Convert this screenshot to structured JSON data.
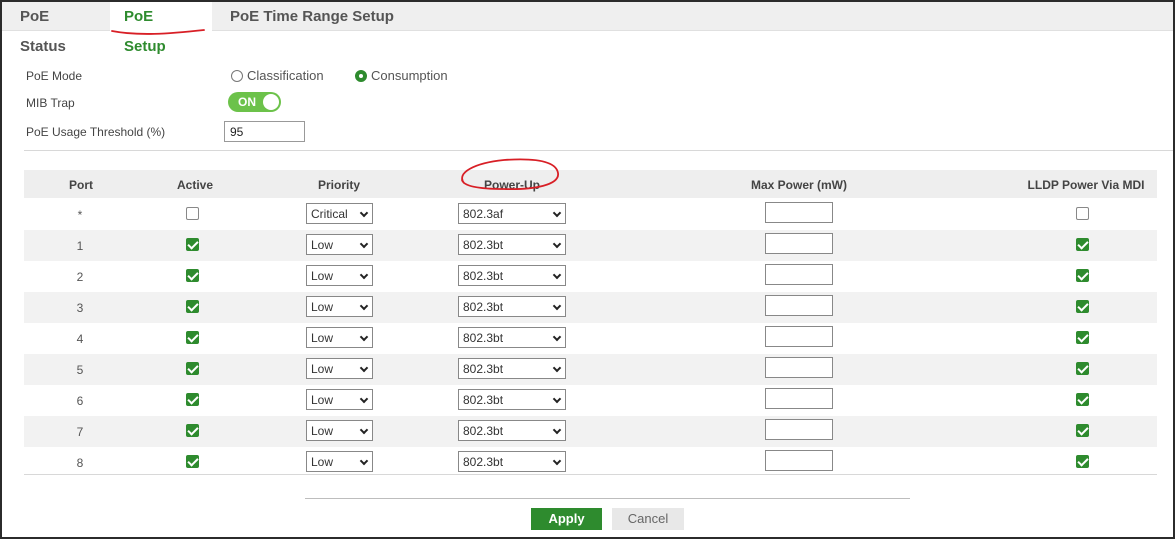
{
  "tabs": [
    {
      "label": "PoE Status",
      "active": false
    },
    {
      "label": "PoE Setup",
      "active": true
    },
    {
      "label": "PoE Time Range Setup",
      "active": false
    }
  ],
  "settings": {
    "poe_mode_label": "PoE Mode",
    "mode_options": [
      "Classification",
      "Consumption"
    ],
    "mode_selected": "Consumption",
    "mib_trap_label": "MIB Trap",
    "mib_trap_state": "ON",
    "threshold_label": "PoE Usage Threshold (%)",
    "threshold_value": "95"
  },
  "table": {
    "headers": {
      "port": "Port",
      "active": "Active",
      "priority": "Priority",
      "power_up": "Power-Up",
      "max_power": "Max Power (mW)",
      "lldp": "LLDP Power Via MDI"
    },
    "rows": [
      {
        "port": "*",
        "active": false,
        "priority": "Critical",
        "power_up": "802.3af",
        "max_power": "",
        "lldp": false
      },
      {
        "port": "1",
        "active": true,
        "priority": "Low",
        "power_up": "802.3bt",
        "max_power": "",
        "lldp": true
      },
      {
        "port": "2",
        "active": true,
        "priority": "Low",
        "power_up": "802.3bt",
        "max_power": "",
        "lldp": true
      },
      {
        "port": "3",
        "active": true,
        "priority": "Low",
        "power_up": "802.3bt",
        "max_power": "",
        "lldp": true
      },
      {
        "port": "4",
        "active": true,
        "priority": "Low",
        "power_up": "802.3bt",
        "max_power": "",
        "lldp": true
      },
      {
        "port": "5",
        "active": true,
        "priority": "Low",
        "power_up": "802.3bt",
        "max_power": "",
        "lldp": true
      },
      {
        "port": "6",
        "active": true,
        "priority": "Low",
        "power_up": "802.3bt",
        "max_power": "",
        "lldp": true
      },
      {
        "port": "7",
        "active": true,
        "priority": "Low",
        "power_up": "802.3bt",
        "max_power": "",
        "lldp": true
      },
      {
        "port": "8",
        "active": true,
        "priority": "Low",
        "power_up": "802.3bt",
        "max_power": "",
        "lldp": true
      }
    ]
  },
  "footer": {
    "apply_label": "Apply",
    "cancel_label": "Cancel"
  },
  "colors": {
    "accent": "#2e8b2e",
    "toggle_on": "#6cc24a",
    "annotation": "#d81f26"
  }
}
